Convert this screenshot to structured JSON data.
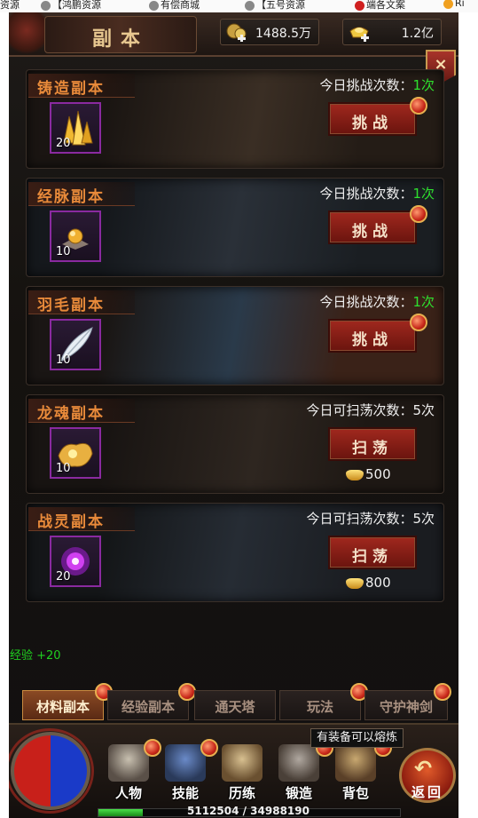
{
  "browser_bookmarks": [
    "资源",
    "【鸿鹏资源",
    "有偿商城",
    "【五号资源",
    "端各文案",
    "Ri"
  ],
  "header": {
    "title": "副本",
    "resources": [
      {
        "icon": "coin-money-icon",
        "value": "1488.5万"
      },
      {
        "icon": "gold-ingot-icon",
        "value": "1.2亿"
      }
    ],
    "close_label": "×"
  },
  "dungeons": [
    {
      "name": "铸造副本",
      "item_icon": "crystal-icon",
      "item_count": "20",
      "limit_label": "今日挑战次数：",
      "limit_value": "1次",
      "limit_color": "green",
      "button": "挑战",
      "cost": ""
    },
    {
      "name": "经脉副本",
      "item_icon": "golden-orb-icon",
      "item_count": "10",
      "limit_label": "今日挑战次数：",
      "limit_value": "1次",
      "limit_color": "green",
      "button": "挑战",
      "cost": ""
    },
    {
      "name": "羽毛副本",
      "item_icon": "feather-icon",
      "item_count": "10",
      "limit_label": "今日挑战次数：",
      "limit_value": "1次",
      "limit_color": "green",
      "button": "挑战",
      "cost": ""
    },
    {
      "name": "龙魂副本",
      "item_icon": "dragon-soul-icon",
      "item_count": "10",
      "limit_label": "今日可扫荡次数：",
      "limit_value": "5次",
      "limit_color": "white",
      "button": "扫荡",
      "cost": "500"
    },
    {
      "name": "战灵副本",
      "item_icon": "war-spirit-icon",
      "item_count": "20",
      "limit_label": "今日可扫荡次数：",
      "limit_value": "5次",
      "limit_color": "white",
      "button": "扫荡",
      "cost": "800"
    }
  ],
  "exp_float": "经验 +20",
  "tabs": [
    "材料副本",
    "经验副本",
    "通天塔",
    "玩法",
    "守护神剑"
  ],
  "active_tab": "材料副本",
  "bottom_menu": {
    "items": [
      "人物",
      "技能",
      "历练",
      "锻造",
      "背包"
    ],
    "back_label": "返回",
    "tooltip": "有装备可以熔炼",
    "exp_text": "5112504 / 34988190",
    "exp_fraction": 0.146
  }
}
